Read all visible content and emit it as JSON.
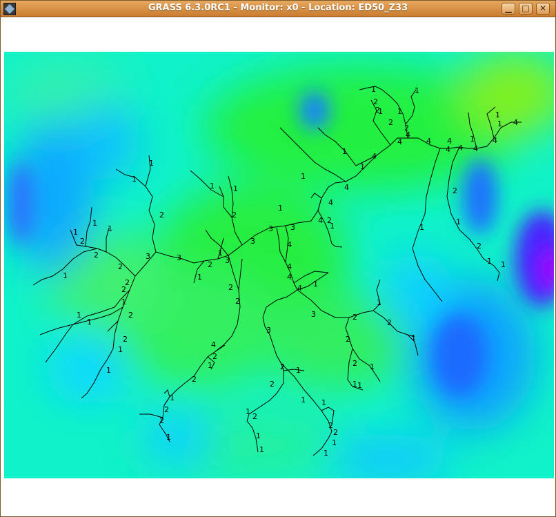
{
  "window": {
    "title": "GRASS 6.3.0RC1 - Monitor: x0 - Location: ED50_Z33",
    "minimize_glyph": "▁",
    "maximize_glyph": "□",
    "close_glyph": "✕"
  },
  "map": {
    "layer": "elevation-raster",
    "colors": [
      "#00ee33",
      "#00ffaa",
      "#00ddff",
      "#0088ff",
      "#2222ff",
      "#8800ff"
    ],
    "stream_order_labels": [
      "1",
      "2",
      "3",
      "4"
    ]
  }
}
